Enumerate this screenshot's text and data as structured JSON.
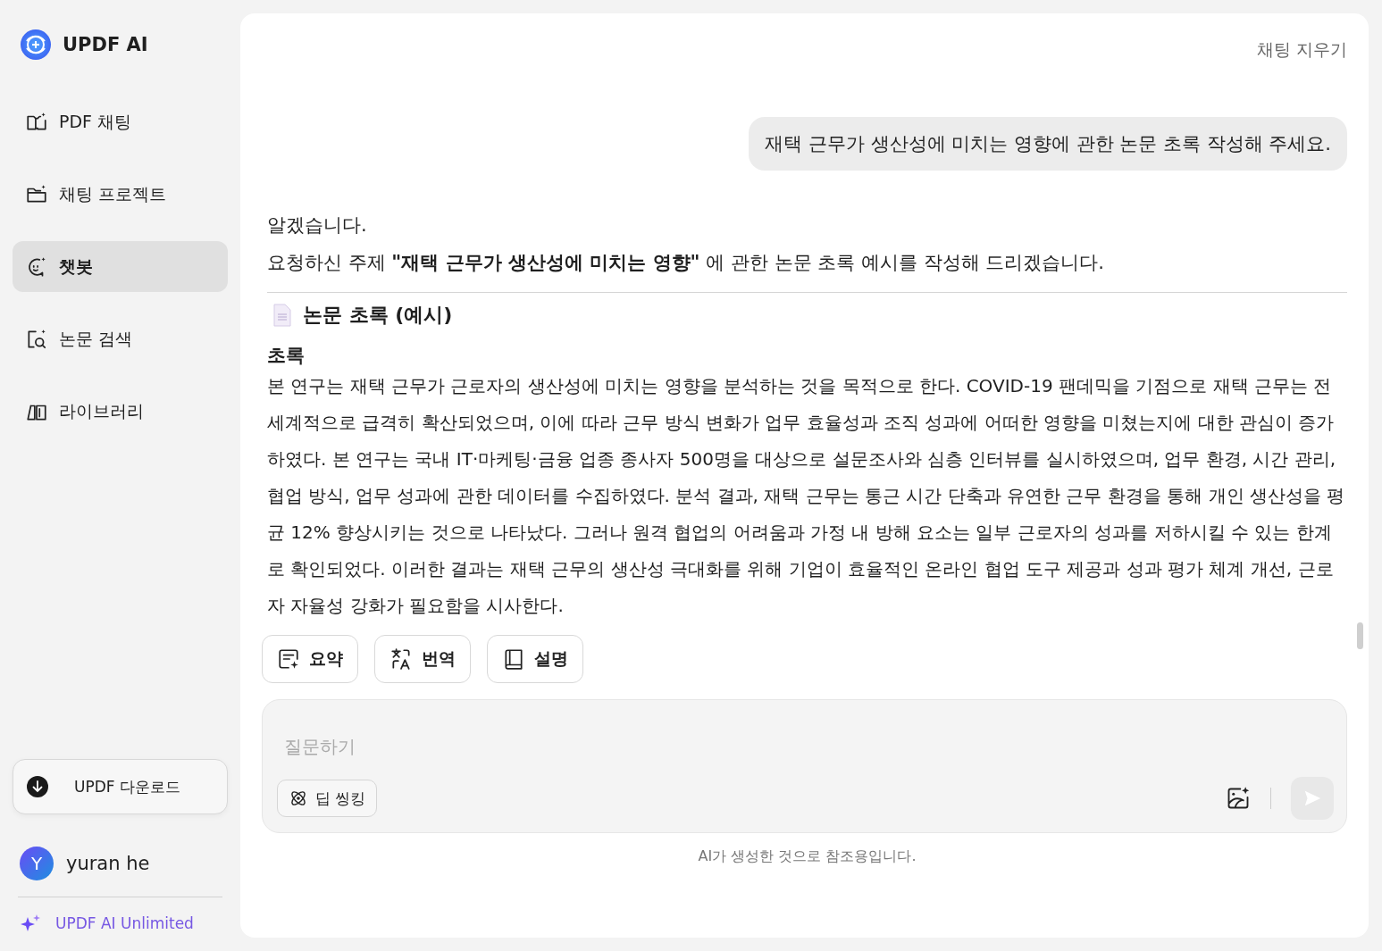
{
  "brand": {
    "name": "UPDF AI"
  },
  "sidebar": {
    "items": [
      {
        "label": "PDF 채팅",
        "kind": "book",
        "selected": false
      },
      {
        "label": "채팅 프로젝트",
        "kind": "folder",
        "selected": false
      },
      {
        "label": "챗봇",
        "kind": "bot",
        "selected": true
      },
      {
        "label": "논문 검색",
        "kind": "search",
        "selected": false
      },
      {
        "label": "라이브러리",
        "kind": "library",
        "selected": false
      }
    ],
    "download_button": "UPDF 다운로드",
    "user": {
      "initial": "Y",
      "name": "yuran he"
    },
    "upgrade_link": "UPDF AI Unlimited"
  },
  "chat": {
    "clear_button": "채팅 지우기",
    "user_message": "재택 근무가 생산성에 미치는 영향에 관한 논문 초록 작성해 주세요.",
    "reply": {
      "intro_lines": [
        "알겠습니다.",
        "요청하신 주제 **\"재택 근무가 생산성에 미치는 영향\"** 에 관한 논문 초록 예시를 작성해 드리겠습니다."
      ],
      "heading": "논문 초록 (예시)",
      "subheading": "초록",
      "paragraph": "본 연구는 재택 근무가 근로자의 생산성에 미치는 영향을 분석하는 것을 목적으로 한다. COVID-19 팬데믹을 기점으로 재택 근무는 전 세계적으로 급격히 확산되었으며, 이에 따라 근무 방식 변화가 업무 효율성과 조직 성과에 어떠한 영향을 미쳤는지에 대한 관심이 증가하였다. 본 연구는 국내 IT·마케팅·금융 업종 종사자 500명을 대상으로 설문조사와 심층 인터뷰를 실시하였으며, 업무 환경, 시간 관리, 협업 방식, 업무 성과에 관한 데이터를 수집하였다. 분석 결과, 재택 근무는 통근 시간 단축과 유연한 근무 환경을 통해 개인 생산성을 평균 12% 향상시키는 것으로 나타났다. 그러나 원격 협업의 어려움과 가정 내 방해 요소는 일부 근로자의 성과를 저하시킬 수 있는 한계로 확인되었다. 이러한 결과는 재택 근무의 생산성 극대화를 위해 기업이 효율적인 온라인 협업 도구 제공과 성과 평가 체계 개선, 근로자 자율성 강화가 필요함을 시사한다."
    },
    "actions": [
      {
        "label": "요약",
        "kind": "summary"
      },
      {
        "label": "번역",
        "kind": "translate"
      },
      {
        "label": "설명",
        "kind": "book"
      }
    ],
    "input": {
      "placeholder": "질문하기",
      "deep_thinking": {
        "label": "딥 씽킹",
        "on": false
      }
    },
    "disclaimer": "AI가 생성한 것으로 참조용입니다."
  }
}
